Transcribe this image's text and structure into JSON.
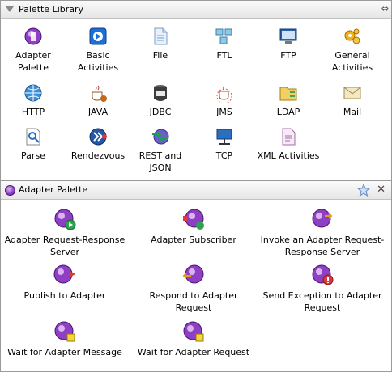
{
  "library": {
    "title": "Palette Library",
    "items": [
      {
        "label": "Adapter Palette",
        "icon": "adapter-palette-icon"
      },
      {
        "label": "Basic Activities",
        "icon": "basic-activities-icon"
      },
      {
        "label": "File",
        "icon": "file-icon"
      },
      {
        "label": "FTL",
        "icon": "ftl-icon"
      },
      {
        "label": "FTP",
        "icon": "ftp-icon"
      },
      {
        "label": "General Activities",
        "icon": "general-activities-icon"
      },
      {
        "label": "HTTP",
        "icon": "http-icon"
      },
      {
        "label": "JAVA",
        "icon": "java-icon"
      },
      {
        "label": "JDBC",
        "icon": "jdbc-icon"
      },
      {
        "label": "JMS",
        "icon": "jms-icon"
      },
      {
        "label": "LDAP",
        "icon": "ldap-icon"
      },
      {
        "label": "Mail",
        "icon": "mail-icon"
      },
      {
        "label": "Parse",
        "icon": "parse-icon"
      },
      {
        "label": "Rendezvous",
        "icon": "rendezvous-icon"
      },
      {
        "label": "REST and JSON",
        "icon": "rest-json-icon"
      },
      {
        "label": "TCP",
        "icon": "tcp-icon"
      },
      {
        "label": "XML Activities",
        "icon": "xml-activities-icon"
      }
    ]
  },
  "adapter_palette": {
    "title": "Adapter Palette",
    "items": [
      {
        "label": "Adapter Request-Response Server",
        "icon": "adapter-request-response-server-icon"
      },
      {
        "label": "Adapter Subscriber",
        "icon": "adapter-subscriber-icon"
      },
      {
        "label": "Invoke an Adapter Request-Response Server",
        "icon": "invoke-adapter-request-icon"
      },
      {
        "label": "Publish to Adapter",
        "icon": "publish-to-adapter-icon"
      },
      {
        "label": "Respond to Adapter Request",
        "icon": "respond-to-adapter-request-icon"
      },
      {
        "label": "Send Exception to Adapter Request",
        "icon": "send-exception-icon"
      },
      {
        "label": "Wait for Adapter Message",
        "icon": "wait-for-adapter-message-icon"
      },
      {
        "label": "Wait for Adapter Request",
        "icon": "wait-for-adapter-request-icon"
      }
    ]
  }
}
